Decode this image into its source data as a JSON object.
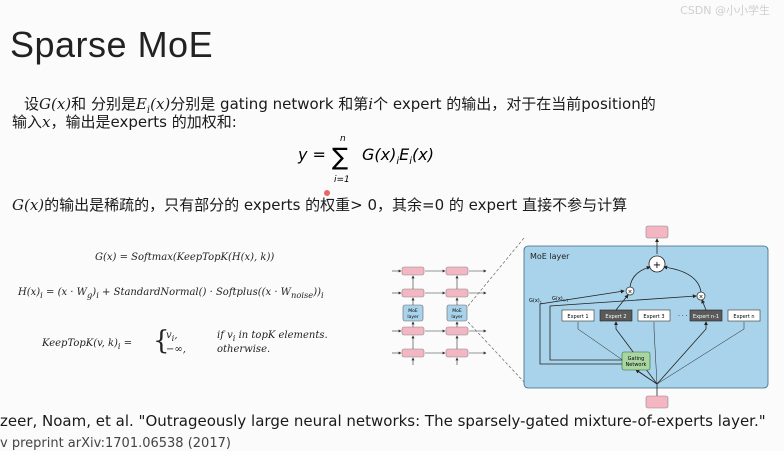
{
  "watermark": "CSDN @小小学生",
  "title": "Sparse MoE",
  "line1": {
    "a": "设",
    "g": "G(x)",
    "b": "和 分别是",
    "e": "E",
    "esub": "i",
    "ex": "(x)",
    "c": "分别是 gating network 和第",
    "i": "i",
    "d": "个 expert 的输出，对于在当前position的"
  },
  "line2": {
    "a": "输入",
    "x": "x",
    "b": "，输出是experts 的加权和:"
  },
  "sum_formula": {
    "lhs": "y =",
    "upper": "n",
    "lower": "i=1",
    "body": "G(x)",
    "sub1": "i",
    "body2": "E",
    "sub2": "i",
    "body3": "(x)"
  },
  "line3": {
    "g": "G(x)",
    "a": "的输出是稀疏的，只有部分的 experts 的权重> 0，其余=0 的 expert 直接不参与计算"
  },
  "equations": {
    "eq1": "G(x) = Softmax(KeepTopK(H(x), k))",
    "eq2_a": "H(x)",
    "eq2_sub": "i",
    "eq2_b": " = (x · W",
    "eq2_g": "g",
    "eq2_c": ")",
    "eq2_sub2": "i",
    "eq2_d": " + StandardNormal() · Softplus((x · W",
    "eq2_noise": "noise",
    "eq2_e": "))",
    "eq2_sub3": "i",
    "eq3_lhs": "KeepTopK(v, k)",
    "eq3_sub": "i",
    "eq3_eq": " =",
    "eq3_case1_v": "v",
    "eq3_case1_vsub": "i",
    "eq3_case1_cond": "if v",
    "eq3_case1_condsub": "i",
    "eq3_case1_cond2": " in topK elements.",
    "eq3_case2_v": "−∞,",
    "eq3_case2_cond": "otherwise."
  },
  "diagram": {
    "moe_block_label": "MoE layer",
    "small_moe_label_1": "MoE",
    "small_moe_label_2": "layer",
    "gx1": "G(x)",
    "gx1_sub": "1",
    "gxn": "G(x)",
    "gxn_sub": "n-1",
    "plus": "+",
    "times": "×",
    "ellipsis": "· · ·",
    "experts": [
      "Expert 1",
      "Expert 2",
      "Expert 3",
      "Expert n-1",
      "Expert n"
    ],
    "gating_1": "Gating",
    "gating_2": "Network"
  },
  "citation": {
    "line1": "zeer, Noam, et al. \"Outrageously large neural networks: The sparsely-gated mixture-of-experts layer.\"",
    "line2": "v preprint arXiv:1701.06538 (2017)"
  },
  "colors": {
    "moe_bg": "#a9d3ea",
    "pink": "#f4b6c2",
    "dark_expert": "#5a5a5a",
    "gating": "#a8d5a2",
    "dot": "#e84a4a"
  }
}
